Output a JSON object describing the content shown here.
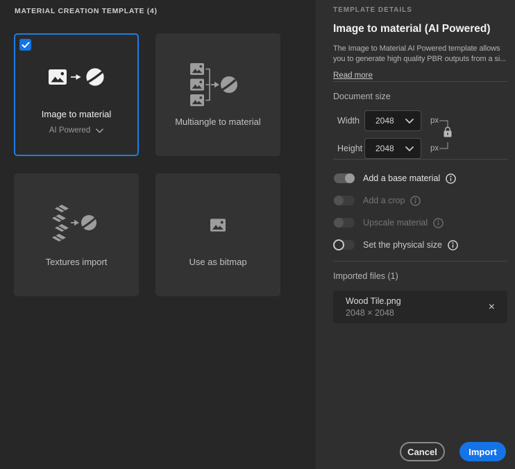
{
  "left_panel": {
    "title": "MATERIAL CREATION TEMPLATE (4)"
  },
  "templates": [
    {
      "label": "Image to material",
      "sub_label": "AI Powered",
      "selected": true
    },
    {
      "label": "Multiangle to material",
      "selected": false
    },
    {
      "label": "Textures import",
      "selected": false
    },
    {
      "label": "Use as bitmap",
      "selected": false
    }
  ],
  "details": {
    "section_title": "TEMPLATE DETAILS",
    "title": "Image to material (AI Powered)",
    "description_lines": [
      "The Image to Material AI Powered template allows",
      "you to generate high quality PBR outputs from a si..."
    ],
    "read_more_label": "Read more",
    "document_size": {
      "label": "Document size",
      "width_label": "Width",
      "width_value": "2048",
      "height_label": "Height",
      "height_value": "2048",
      "unit": "px",
      "linked": true
    },
    "toggles": [
      {
        "label": "Add a base material",
        "state": "on",
        "enabled": true
      },
      {
        "label": "Add a crop",
        "state": "off",
        "enabled": false
      },
      {
        "label": "Upscale material",
        "state": "off",
        "enabled": false
      },
      {
        "label": "Set the physical size",
        "state": "off",
        "enabled": true
      }
    ],
    "imported_files": {
      "label": "Imported files (1)",
      "files": [
        {
          "name": "Wood Tile.png",
          "dimensions": "2048 × 2048"
        }
      ]
    },
    "footer": {
      "cancel_label": "Cancel",
      "import_label": "Import"
    }
  },
  "colors": {
    "accent_blue": "#1473e6",
    "selection_border": "#1f7ce6",
    "left_panel_bg": "#272727",
    "right_panel_bg": "#2f2f2f",
    "card_bg": "#333333",
    "selected_card_bg": "#2a2a2a"
  }
}
